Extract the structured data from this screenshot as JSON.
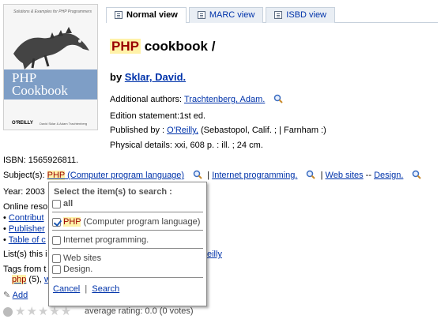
{
  "cover": {
    "tagline": "Solutions & Examples for PHP Programmers",
    "title_line1": "PHP",
    "title_line2": "Cookbook",
    "publisher": "O'REILLY",
    "authors": "David Sklar & Adam Trachtenberg"
  },
  "tabs": [
    {
      "label": "Normal view",
      "icon": "normal-view-icon"
    },
    {
      "label": "MARC view",
      "icon": "marc-view-icon"
    },
    {
      "label": "ISBD view",
      "icon": "isbd-view-icon"
    }
  ],
  "record": {
    "title_highlight": "PHP",
    "title_rest": " cookbook /",
    "by_label": "by ",
    "author": "Sklar, David.",
    "additional_label": "Additional authors: ",
    "additional_author": "Trachtenberg, Adam.",
    "edition_label": "Edition statement:",
    "edition_value": "1st ed.",
    "published_label": "Published by : ",
    "publisher": "O'Reilly,",
    "published_rest": " (Sebastopol, Calif. ; | Farnham :)",
    "physical_label": "Physical details: ",
    "physical_value": "xxi, 608 p. : ill. ; 24 cm.",
    "isbn": "ISBN: 1565926811.",
    "subjects_label": "Subject(s): ",
    "subject1_hl": "PHP",
    "subject1_rest": " (Computer program language)",
    "subject_sep": "|",
    "subject2": "Internet programming.",
    "subject3a": "Web sites",
    "subject3_sep": " -- ",
    "subject3b": "Design.",
    "year": "Year: 2003",
    "online_label": "Online reso",
    "online_links": [
      "Contribut",
      "Publisher",
      "Table of c"
    ],
    "lists_label": "List(s) this i",
    "lists_link_tail": "eilly",
    "tags_label": "Tags from t",
    "tag_hl": "php",
    "tag_count": " (5), ",
    "tag_tail": "w",
    "add_label": "Add",
    "rating_text": "average rating: 0.0 (0 votes)"
  },
  "popup": {
    "header": "Select the item(s) to search :",
    "all_label": "all",
    "options": [
      {
        "hl": "PHP",
        "rest": " (Computer program language)",
        "checked": true
      },
      {
        "hl": "",
        "rest": "Internet programming.",
        "checked": false
      },
      {
        "hl": "",
        "rest": "Web sites",
        "checked": false
      },
      {
        "hl": "",
        "rest": "Design.",
        "checked": false
      }
    ],
    "cancel": "Cancel",
    "sep": "|",
    "search": "Search"
  }
}
